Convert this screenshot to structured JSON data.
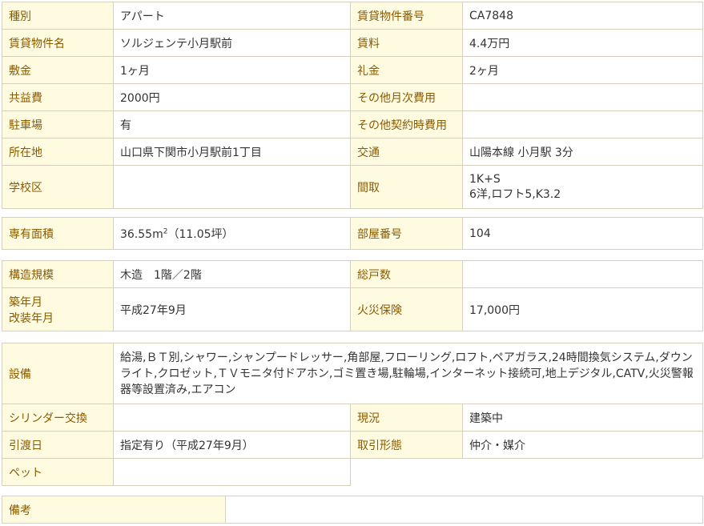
{
  "basic": {
    "type_label": "種別",
    "type_value": "アパート",
    "id_label": "賃貸物件番号",
    "id_value": "CA7848",
    "name_label": "賃貸物件名",
    "name_value": "ソルジェンテ小月駅前",
    "rent_label": "賃料",
    "rent_value": "4.4万円",
    "deposit_label": "敷金",
    "deposit_value": "1ヶ月",
    "keymoney_label": "礼金",
    "keymoney_value": "2ヶ月",
    "common_label": "共益費",
    "common_value": "2000円",
    "other_monthly_label": "その他月次費用",
    "other_monthly_value": "",
    "parking_label": "駐車場",
    "parking_value": "有",
    "other_contract_label": "その他契約時費用",
    "other_contract_value": "",
    "address_label": "所在地",
    "address_value": "山口県下関市小月駅前1丁目",
    "transport_label": "交通",
    "transport_value": "山陽本線 小月駅 3分",
    "school_label": "学校区",
    "school_value": "",
    "layout_label": "間取",
    "layout_line1": "1K+S",
    "layout_line2": "6洋,ロフト5,K3.2"
  },
  "area": {
    "area_label": "専有面積",
    "area_value": "36.55m",
    "area_sup": "2",
    "area_tsubo": "（11.05坪）",
    "room_label": "部屋番号",
    "room_value": "104"
  },
  "building": {
    "structure_label": "構造規模",
    "structure_value": "木造　1階／2階",
    "units_label": "総戸数",
    "units_value": "",
    "built_label1": "築年月",
    "built_label2": "改装年月",
    "built_value": "平成27年9月",
    "insurance_label": "火災保険",
    "insurance_value": "17,000円"
  },
  "equipment": {
    "equip_label": "設備",
    "equip_value": "給湯,ＢＴ別,シャワー,シャンプードレッサー,角部屋,フローリング,ロフト,ペアガラス,24時間換気システム,ダウンライト,クロゼット,ＴＶモニタ付ドアホン,ゴミ置き場,駐輪場,インターネット接続可,地上デジタル,CATV,火災警報器等設置済み,エアコン",
    "cylinder_label": "シリンダー交換",
    "cylinder_value": "",
    "status_label": "現況",
    "status_value": "建築中",
    "handover_label": "引渡日",
    "handover_value": "指定有り（平成27年9月）",
    "deal_label": "取引形態",
    "deal_value": "仲介・媒介",
    "pet_label": "ペット",
    "pet_value": ""
  },
  "remarks": {
    "label": "備考",
    "value": ""
  }
}
